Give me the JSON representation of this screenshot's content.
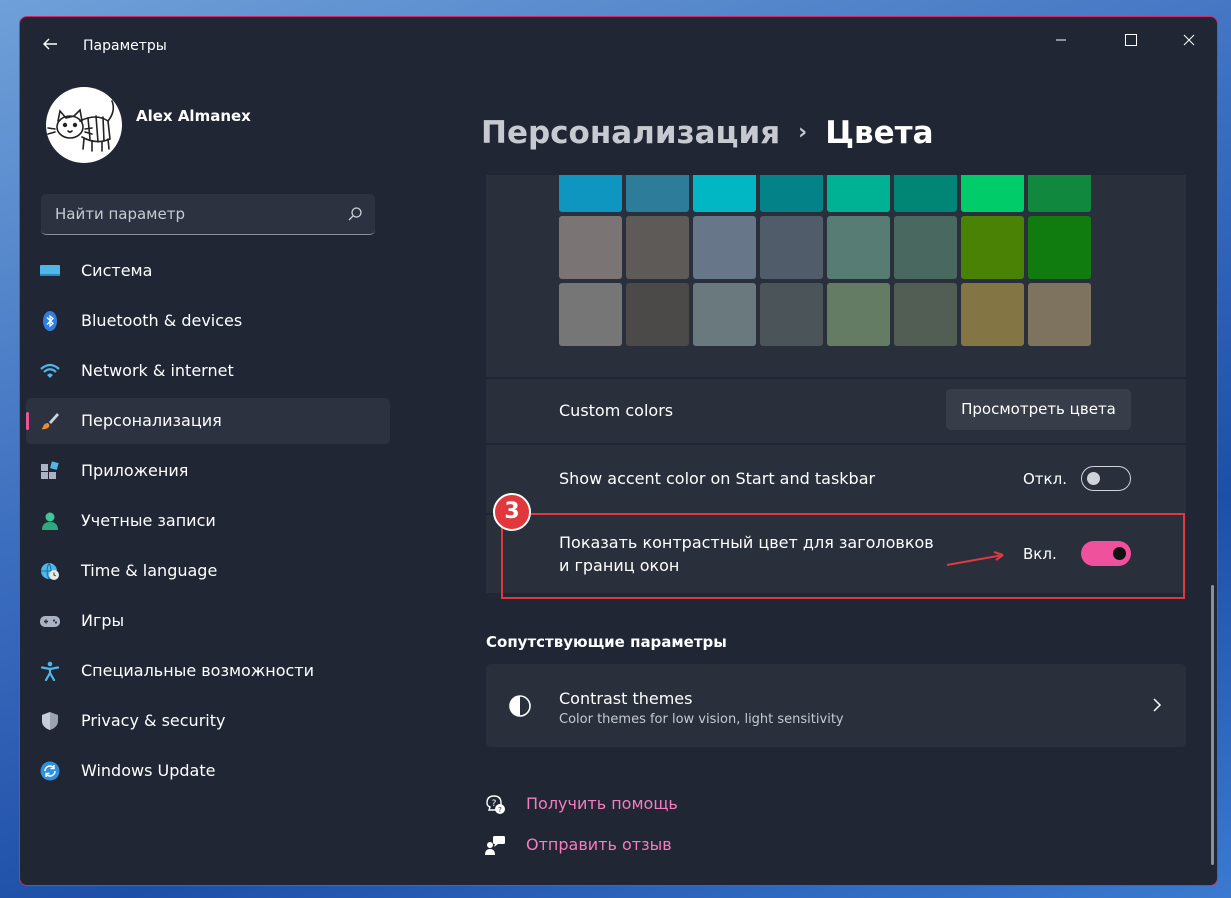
{
  "window": {
    "title": "Параметры"
  },
  "profile": {
    "name": "Alex Almanex"
  },
  "search": {
    "placeholder": "Найти параметр"
  },
  "sidebar": {
    "items": [
      {
        "label": "Система",
        "icon": "monitor-icon",
        "active": false
      },
      {
        "label": "Bluetooth & devices",
        "icon": "bluetooth-icon",
        "active": false
      },
      {
        "label": "Network & internet",
        "icon": "wifi-icon",
        "active": false
      },
      {
        "label": "Персонализация",
        "icon": "brush-icon",
        "active": true
      },
      {
        "label": "Приложения",
        "icon": "apps-icon",
        "active": false
      },
      {
        "label": "Учетные записи",
        "icon": "person-icon",
        "active": false
      },
      {
        "label": "Time & language",
        "icon": "globe-clock-icon",
        "active": false
      },
      {
        "label": "Игры",
        "icon": "gamepad-icon",
        "active": false
      },
      {
        "label": "Специальные возможности",
        "icon": "accessibility-icon",
        "active": false
      },
      {
        "label": "Privacy & security",
        "icon": "shield-icon",
        "active": false
      },
      {
        "label": "Windows Update",
        "icon": "update-icon",
        "active": false
      }
    ]
  },
  "breadcrumb": {
    "parent": "Персонализация",
    "separator": "›",
    "current": "Цвета"
  },
  "swatches": [
    [
      "#0f96c0",
      "#2d7d9a",
      "#00b7c3",
      "#038387",
      "#00b294",
      "#018574",
      "#00cc6a",
      "#10893e"
    ],
    [
      "#7a7574",
      "#5d5a58",
      "#68768a",
      "#515c6b",
      "#567c73",
      "#486860",
      "#498205",
      "#107c10"
    ],
    [
      "#767676",
      "#4c4a48",
      "#69797e",
      "#4a5459",
      "#647c64",
      "#525e54",
      "#847545",
      "#7e735f"
    ]
  ],
  "custom_colors": {
    "label": "Custom colors",
    "button": "Просмотреть цвета"
  },
  "accent_start": {
    "label": "Show accent color on Start and taskbar",
    "state_text": "Откл.",
    "on": false
  },
  "accent_titlebars": {
    "label_line1": "Показать контрастный цвет для заголовков",
    "label_line2": "и границ окон",
    "state_text": "Вкл.",
    "on": true
  },
  "annotation": {
    "step": "3",
    "color": "#e0383d"
  },
  "related": {
    "title": "Сопутствующие параметры",
    "contrast_themes": {
      "title": "Contrast themes",
      "subtitle": "Color themes for low vision, light sensitivity"
    }
  },
  "links": {
    "help": "Получить помощь",
    "feedback": "Отправить отзыв"
  },
  "colors": {
    "accent": "#f0519c",
    "link": "#f57cbf",
    "background": "#202634",
    "card": "#2a2f3c"
  }
}
